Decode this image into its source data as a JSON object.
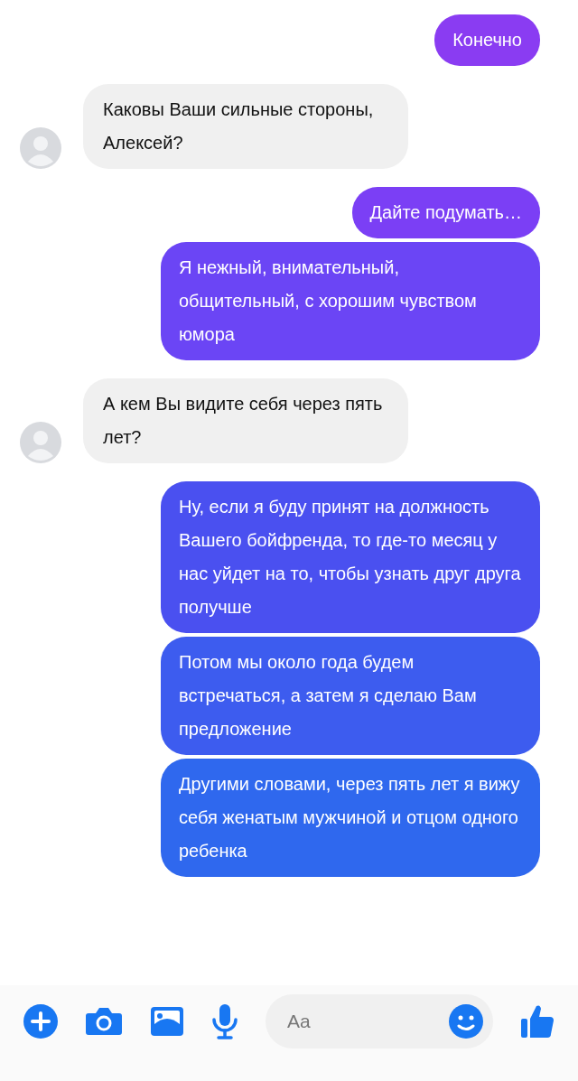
{
  "messages": [
    {
      "kind": "outgoing",
      "text": "Конечно",
      "color": "#8a3cf2"
    },
    {
      "kind": "incoming",
      "text": "Каковы Ваши сильные стороны, Алексей?"
    },
    {
      "kind": "outgoing",
      "text": "Дайте подумать…",
      "color": "#7b3ff5"
    },
    {
      "kind": "outgoing",
      "text": "Я нежный, внимательный, общительный, с хорошим чувством юмора",
      "color": "#6b45f5"
    },
    {
      "kind": "incoming",
      "text": "А кем Вы видите себя через пять лет?"
    },
    {
      "kind": "outgoing",
      "text": "Ну, если я буду принят на должность Вашего бойфренда, то где-то месяц у нас уйдет на то, чтобы узнать друг друга получше",
      "color": "#4a50f0"
    },
    {
      "kind": "outgoing",
      "text": "Потом мы около года будем встречаться, а затем я сделаю Вам предложение",
      "color": "#3d5cef"
    },
    {
      "kind": "outgoing",
      "text": "Другими словами, через пять лет я вижу себя женатым мужчиной и отцом одного ребенка",
      "color": "#2f68ee"
    }
  ],
  "composer": {
    "placeholder": "Aa"
  }
}
